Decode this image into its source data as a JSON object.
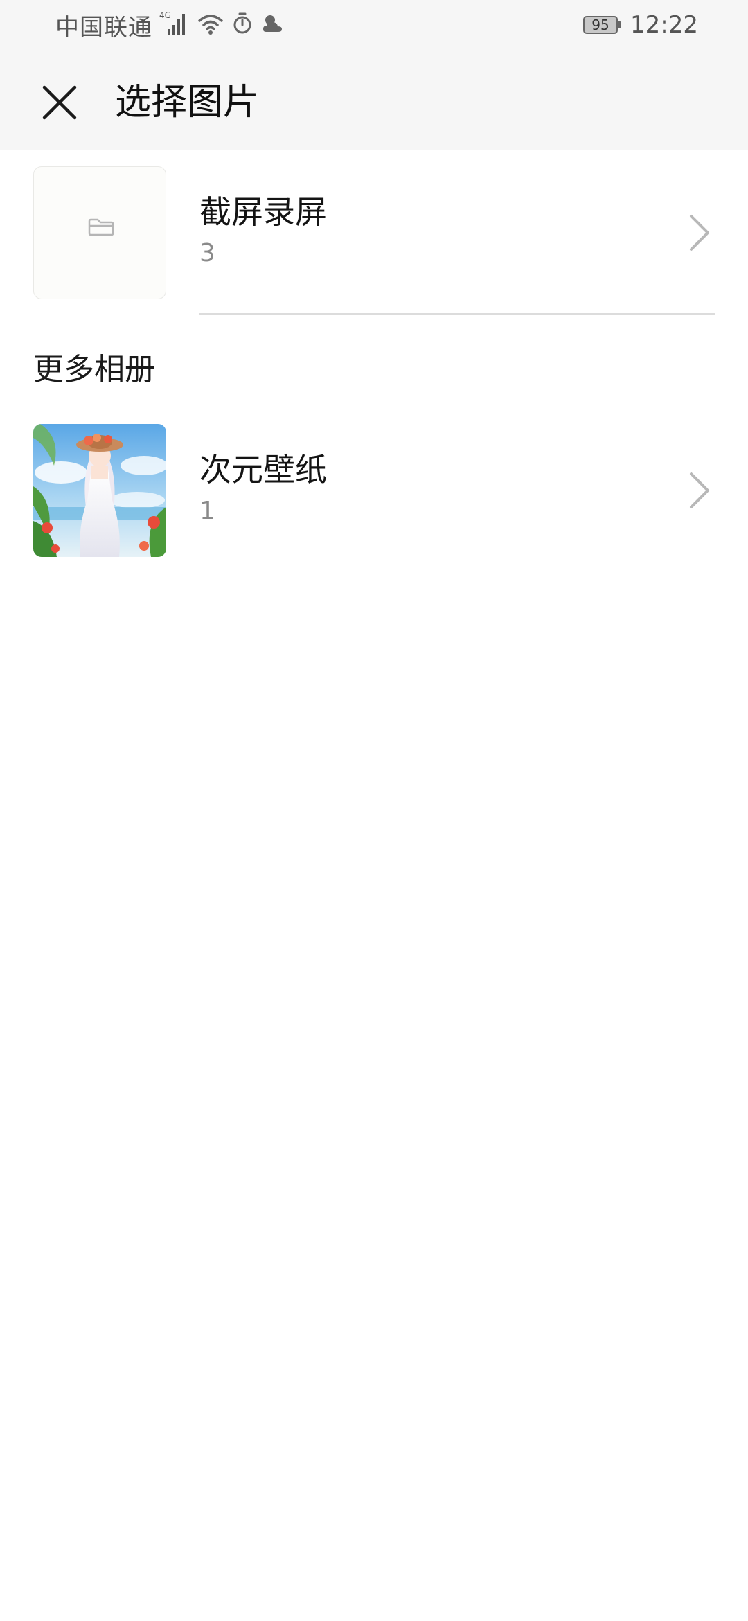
{
  "status_bar": {
    "carrier": "中国联通",
    "network_type": "4G",
    "battery_level": "95",
    "time": "12:22",
    "icons": [
      "signal-icon",
      "wifi-icon",
      "alarm-icon",
      "weather-icon"
    ]
  },
  "app_bar": {
    "title": "选择图片",
    "close_icon": "close-icon"
  },
  "albums": [
    {
      "name": "截屏录屏",
      "count": "3",
      "thumbnail": "folder-icon"
    }
  ],
  "more_section": {
    "header": "更多相册",
    "albums": [
      {
        "name": "次元壁纸",
        "count": "1",
        "thumbnail": "anime-wallpaper-image"
      }
    ]
  },
  "colors": {
    "header_bg": "#f6f6f6",
    "text_primary": "#141414",
    "text_secondary": "#8a8a8a",
    "chevron": "#b8b8b8"
  }
}
